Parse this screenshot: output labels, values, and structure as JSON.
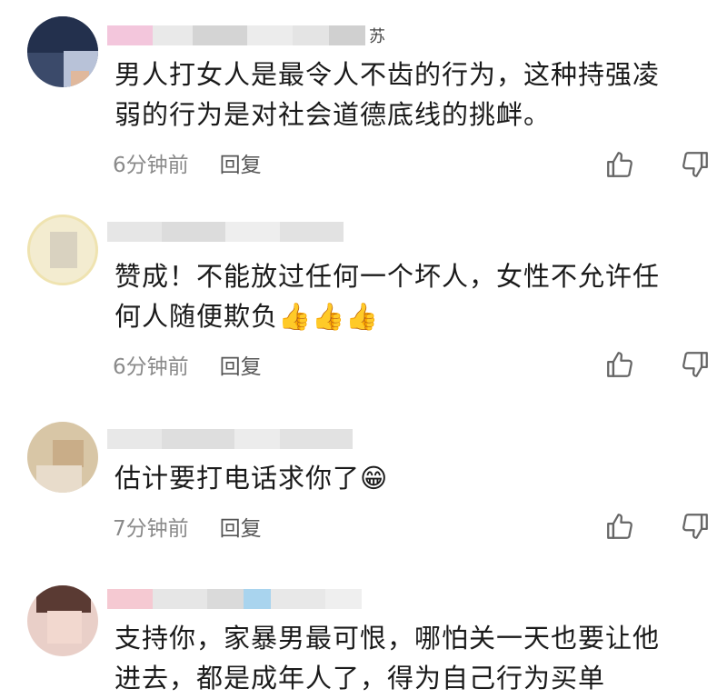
{
  "comments": [
    {
      "username_suffix": "苏",
      "text_line1": "男人打女人是最令人不齿的行为，这种持强凌",
      "text_line2": "弱的行为是对社会道德底线的挑衅。",
      "emoji": "",
      "time": "6分钟前",
      "reply_label": "回复"
    },
    {
      "username_suffix": "",
      "text_line1": "赞成！不能放过任何一个坏人，女性不允许任",
      "text_line2": "何人随便欺负",
      "emoji": "👍👍👍",
      "time": "6分钟前",
      "reply_label": "回复"
    },
    {
      "username_suffix": "",
      "text_line1": "估计要打电话求你了",
      "text_line2": "",
      "emoji": "😁",
      "time": "7分钟前",
      "reply_label": "回复"
    },
    {
      "username_suffix": "",
      "text_line1": "支持你，家暴男最可恨，哪怕关一天也要让他",
      "text_line2": "进去，都是成年人了，得为自己行为买单",
      "emoji": "",
      "time": "",
      "reply_label": ""
    }
  ],
  "icons": {
    "like": "thumbs-up-icon",
    "dislike": "thumbs-down-icon"
  },
  "colors": {
    "meta": "#8a8a8a",
    "text": "#1a1a1a"
  }
}
